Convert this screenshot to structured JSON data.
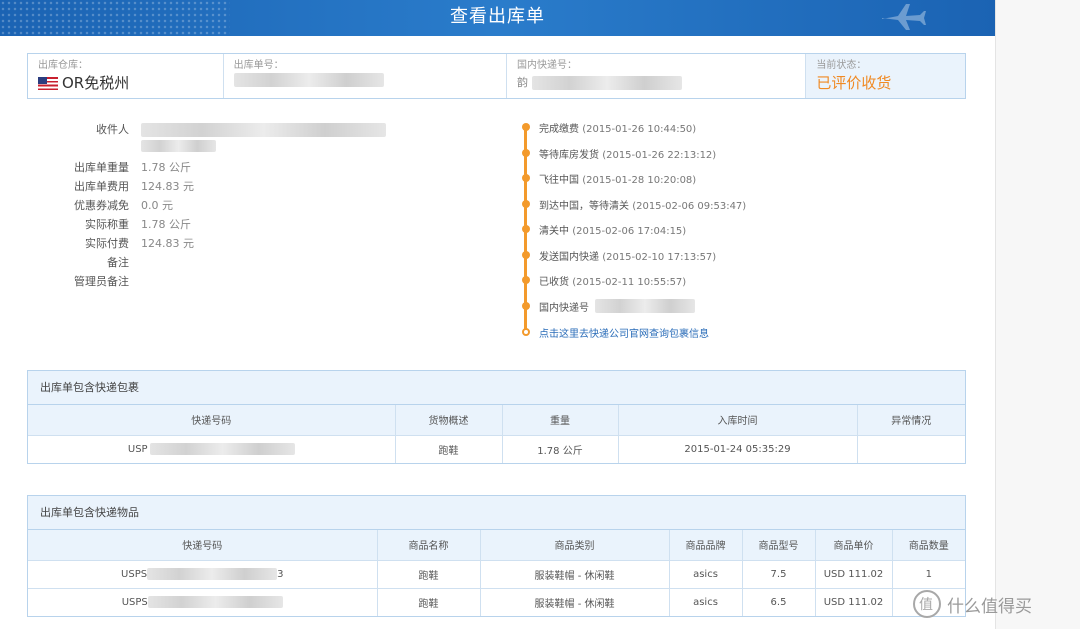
{
  "header": {
    "title": "查看出库单"
  },
  "summary": {
    "warehouse_label": "出库仓库：",
    "warehouse_value": "OR免税州",
    "order_no_label": "出库单号：",
    "domestic_label": "国内快递号：",
    "domestic_prefix": "韵",
    "status_label": "当前状态：",
    "status_value": "已评价收货"
  },
  "info": {
    "recipient_label": "收件人",
    "weight_label": "出库单重量",
    "weight_value": "1.78 公斤",
    "fee_label": "出库单费用",
    "fee_value": "124.83 元",
    "coupon_label": "优惠券减免",
    "coupon_value": "0.0 元",
    "actual_weight_label": "实际称重",
    "actual_weight_value": "1.78 公斤",
    "actual_pay_label": "实际付费",
    "actual_pay_value": "124.83 元",
    "remark_label": "备注",
    "admin_remark_label": "管理员备注"
  },
  "timeline": [
    {
      "text": "完成缴费",
      "time": "(2015-01-26 10:44:50)"
    },
    {
      "text": "等待库房发货",
      "time": "(2015-01-26 22:13:12)"
    },
    {
      "text": "飞往中国",
      "time": "(2015-01-28 10:20:08)"
    },
    {
      "text": "到达中国，等待清关",
      "time": "(2015-02-06 09:53:47)"
    },
    {
      "text": "清关中",
      "time": "(2015-02-06 17:04:15)"
    },
    {
      "text": "发送国内快递",
      "time": "(2015-02-10 17:13:57)"
    },
    {
      "text": "已收货",
      "time": "(2015-02-11 10:55:57)"
    },
    {
      "text": "国内快递号",
      "time": ""
    }
  ],
  "timeline_link": "点击这里去快递公司官网查询包裹信息",
  "packages": {
    "title": "出库单包含快递包裹",
    "headers": [
      "快递号码",
      "货物概述",
      "重量",
      "入库时间",
      "异常情况"
    ],
    "rows": [
      {
        "tracking": "USP",
        "desc": "跑鞋",
        "weight": "1.78 公斤",
        "time": "2015-01-24 05:35:29",
        "exception": ""
      }
    ]
  },
  "items": {
    "title": "出库单包含快递物品",
    "headers": [
      "快递号码",
      "商品名称",
      "商品类别",
      "商品品牌",
      "商品型号",
      "商品单价",
      "商品数量"
    ],
    "rows": [
      {
        "tracking": "USPS",
        "tail": "3",
        "name": "跑鞋",
        "category": "服装鞋帽 - 休闲鞋",
        "brand": "asics",
        "model": "7.5",
        "price": "USD 111.02",
        "qty": "1"
      },
      {
        "tracking": "USPS",
        "tail": "",
        "name": "跑鞋",
        "category": "服装鞋帽 - 休闲鞋",
        "brand": "asics",
        "model": "6.5",
        "price": "USD 111.02",
        "qty": ""
      }
    ]
  },
  "watermark": "什么值得买"
}
